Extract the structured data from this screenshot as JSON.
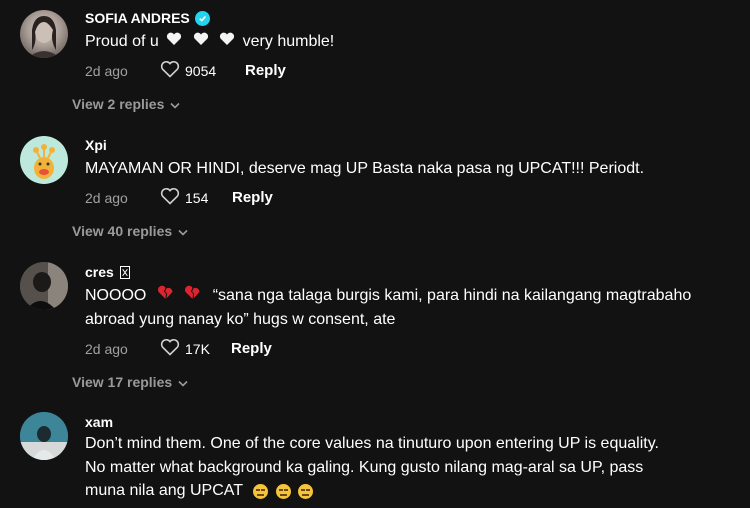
{
  "comments": [
    {
      "username": "SOFIA ANDRES",
      "text_before": "Proud of u",
      "text_after": "very humble!",
      "time": "2d ago",
      "likes": "9054",
      "reply_label": "Reply",
      "view_replies": "View 2 replies"
    },
    {
      "username": "Xpi",
      "text": "MAYAMAN OR HINDI, deserve mag UP Basta naka pasa ng UPCAT!!! Periodt.",
      "time": "2d ago",
      "likes": "154",
      "reply_label": "Reply",
      "view_replies": "View 40 replies"
    },
    {
      "username": "cres",
      "text_prefix": "NOOOO",
      "text_line1": "“sana nga talaga burgis kami, para hindi na kailangang magtrabaho",
      "text_line2": "abroad yung nanay ko” hugs w consent, ate",
      "time": "2d ago",
      "likes": "17K",
      "reply_label": "Reply",
      "view_replies": "View 17 replies"
    },
    {
      "username": "xam",
      "text_line1": "Don’t mind them. One of the core values na tinuturo upon entering UP is equality.",
      "text_line2": "No matter what background ka galing. Kung gusto nilang mag-aral sa UP, pass",
      "text_line3": "muna nila ang UPCAT"
    }
  ],
  "icons": {
    "verified": "verified-badge-icon",
    "like": "heart-outline-icon",
    "chevron": "chevron-down-icon",
    "white_heart": "white-heart-emoji",
    "broken_heart": "broken-heart-emoji",
    "expressionless": "expressionless-face-emoji"
  },
  "colors": {
    "background": "#121212",
    "verified": "#20d5ec",
    "muted": "#a0a0a0",
    "broken_heart": "#e0242f"
  }
}
